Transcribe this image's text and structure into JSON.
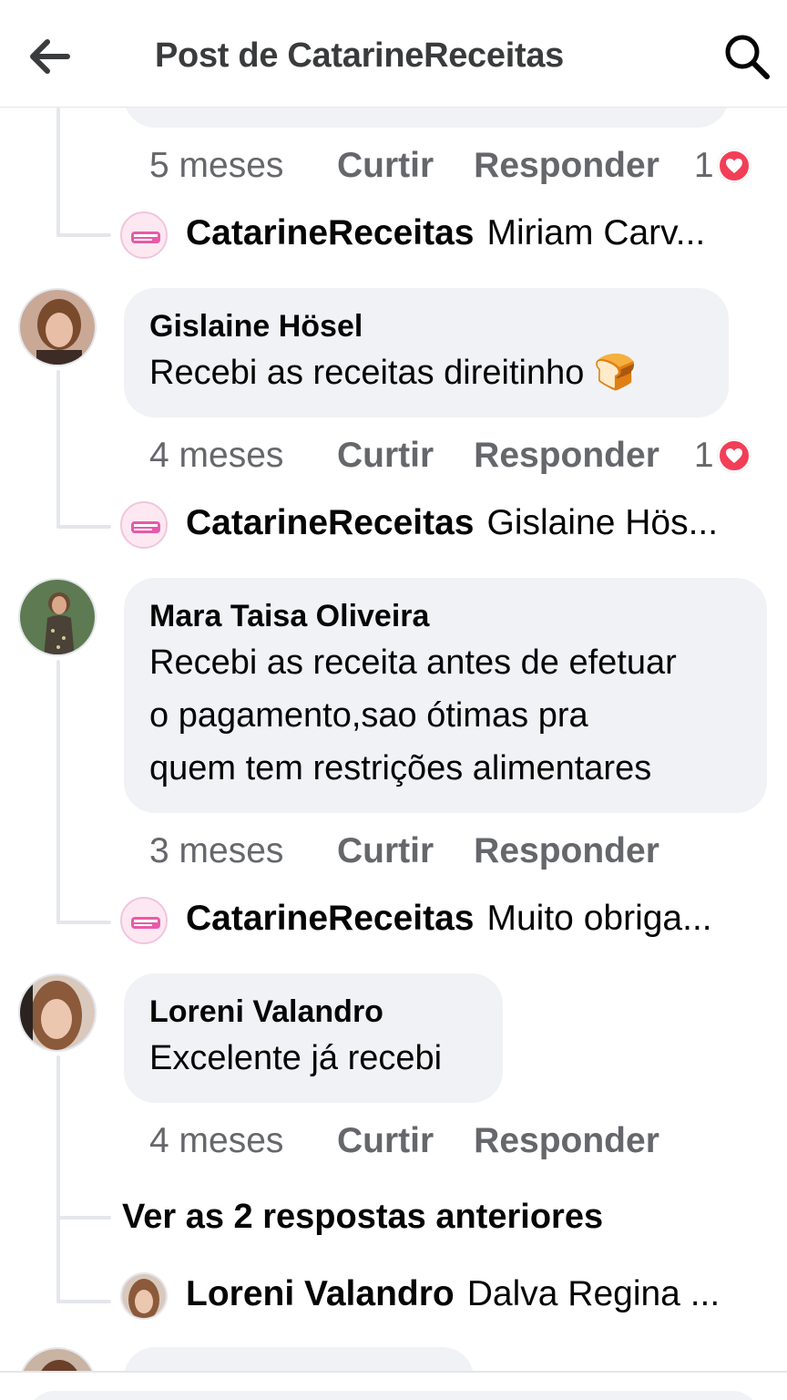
{
  "header": {
    "title": "Post de CatarineReceitas",
    "back_icon": "arrow-left-icon",
    "search_icon": "search-icon"
  },
  "colors": {
    "text_primary": "#050505",
    "text_secondary": "#65676b",
    "bubble_bg": "#f0f2f5",
    "reaction_heart": "#f33e58",
    "line": "#e4e6eb"
  },
  "actions": {
    "like": "Curtir",
    "reply": "Responder"
  },
  "comments": [
    {
      "time": "5 meses",
      "reaction_count": "1",
      "reaction_icon": "heart-reaction-icon",
      "reply": {
        "author": "CatarineReceitas",
        "text": "Miriam Carv..."
      }
    },
    {
      "author": "Gislaine Hösel",
      "text": "Recebi as receitas direitinho 🍞",
      "time": "4 meses",
      "reaction_count": "1",
      "reaction_icon": "heart-reaction-icon",
      "reply": {
        "author": "CatarineReceitas",
        "text": "Gislaine Hös..."
      }
    },
    {
      "author": "Mara Taisa Oliveira",
      "text_lines": [
        "Recebi as receita antes de efetuar",
        "o pagamento,sao ótimas pra",
        "quem tem restrições  alimentares"
      ],
      "time": "3 meses",
      "reply": {
        "author": "CatarineReceitas",
        "text": "Muito obriga..."
      }
    },
    {
      "author": "Loreni Valandro",
      "text": "Excelente já recebi",
      "time": "4 meses",
      "more_replies": "Ver as 2 respostas anteriores",
      "reply": {
        "author": "Loreni Valandro",
        "text": "Dalva Regina ..."
      }
    }
  ]
}
